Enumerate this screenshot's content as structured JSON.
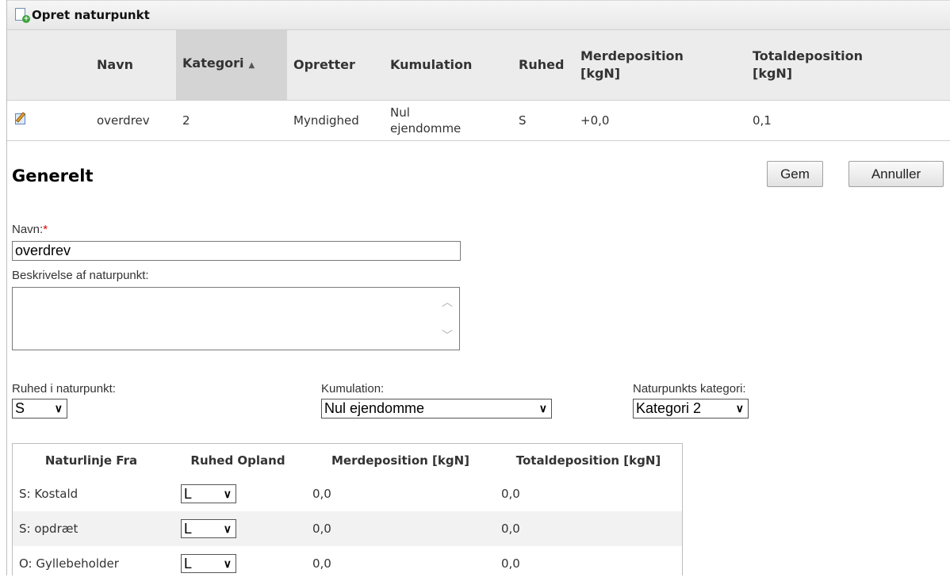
{
  "title": "Opret naturpunkt",
  "grid": {
    "columns": [
      "Navn",
      "Kategori",
      "Opretter",
      "Kumulation",
      "Ruhed",
      "Merdeposition\n[kgN]",
      "Totaldeposition\n[kgN]"
    ],
    "sort_indicator": "▲",
    "row": {
      "navn": "overdrev",
      "kategori": "2",
      "opretter": "Myndighed",
      "kumulation": "Nul\nejendomme",
      "ruhed": "S",
      "merdeposition": "+0,0",
      "totaldeposition": "0,1"
    }
  },
  "section": {
    "title": "Generelt",
    "save_label": "Gem",
    "cancel_label": "Annuller"
  },
  "form": {
    "navn_label": "Navn:",
    "required_mark": "*",
    "navn_value": "overdrev",
    "beskrivelse_label": "Beskrivelse af naturpunkt:",
    "beskrivelse_value": "",
    "ruhed_label": "Ruhed i naturpunkt:",
    "ruhed_value": "S",
    "kumulation_label": "Kumulation:",
    "kumulation_value": "Nul ejendomme",
    "kategori_label": "Naturpunkts kategori:",
    "kategori_value": "Kategori 2"
  },
  "subgrid": {
    "headers": [
      "Naturlinje Fra",
      "Ruhed Opland",
      "Merdeposition [kgN]",
      "Totaldeposition [kgN]"
    ],
    "rows": [
      {
        "fra": "S: Kostald",
        "ruhed": "L",
        "mer": "0,0",
        "total": "0,0"
      },
      {
        "fra": "S: opdræt",
        "ruhed": "L",
        "mer": "0,0",
        "total": "0,0"
      },
      {
        "fra": "O: Gyllebeholder",
        "ruhed": "L",
        "mer": "0,0",
        "total": "0,0"
      }
    ]
  }
}
